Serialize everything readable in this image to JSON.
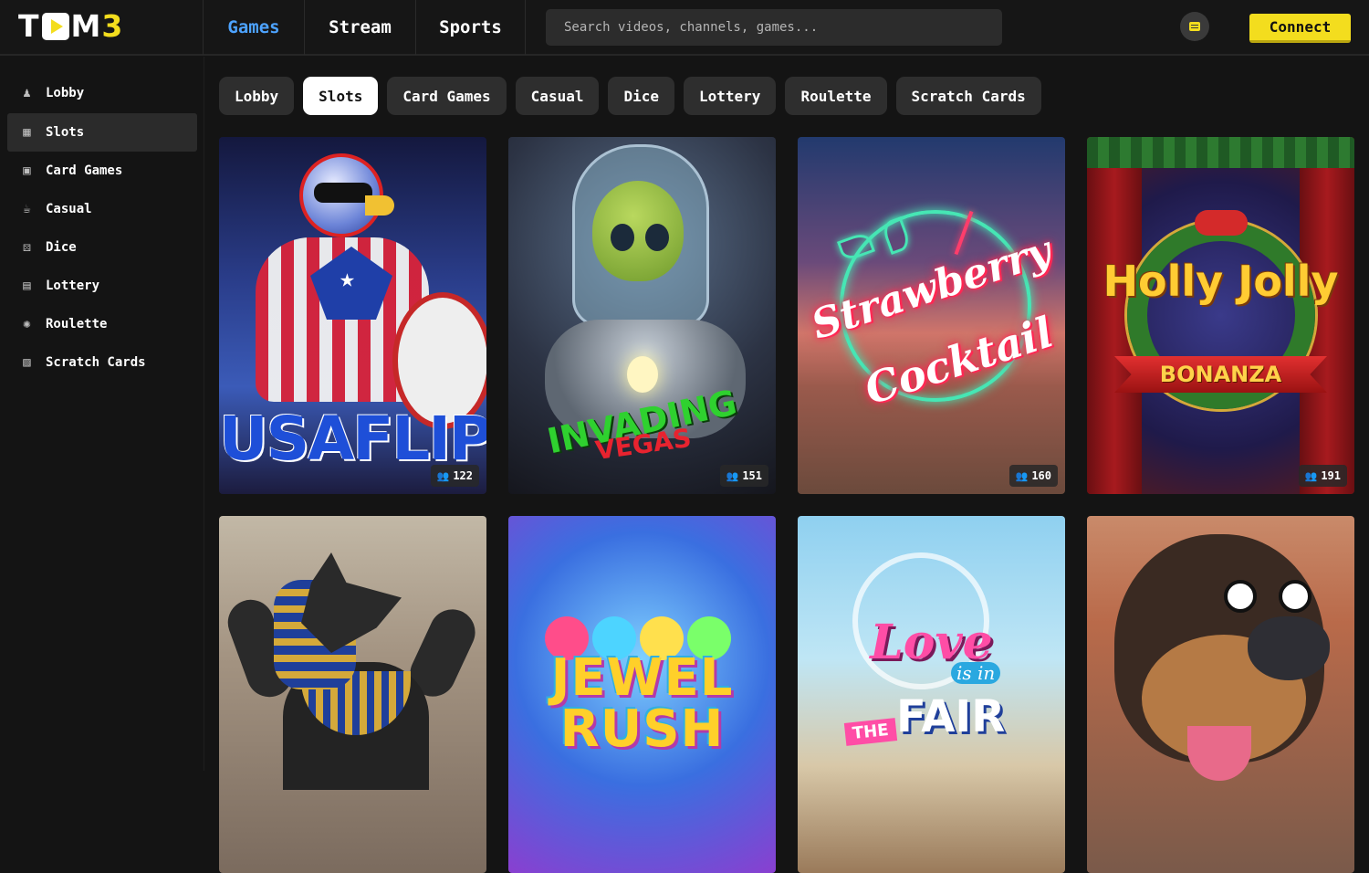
{
  "header": {
    "logo": {
      "part1": "T",
      "part2": "M",
      "part3": "3"
    },
    "tabs": [
      {
        "label": "Games",
        "active": true
      },
      {
        "label": "Stream",
        "active": false
      },
      {
        "label": "Sports",
        "active": false
      }
    ],
    "search": {
      "placeholder": "Search videos, channels, games...",
      "value": ""
    },
    "chat_icon": "chat-icon",
    "connect_label": "Connect"
  },
  "sidebar": {
    "items": [
      {
        "label": "Lobby",
        "icon": "lobby-icon",
        "active": false
      },
      {
        "label": "Slots",
        "icon": "slots-icon",
        "active": true
      },
      {
        "label": "Card Games",
        "icon": "card-games-icon",
        "active": false
      },
      {
        "label": "Casual",
        "icon": "casual-icon",
        "active": false
      },
      {
        "label": "Dice",
        "icon": "dice-icon",
        "active": false
      },
      {
        "label": "Lottery",
        "icon": "lottery-icon",
        "active": false
      },
      {
        "label": "Roulette",
        "icon": "roulette-icon",
        "active": false
      },
      {
        "label": "Scratch Cards",
        "icon": "scratch-cards-icon",
        "active": false
      }
    ]
  },
  "categories": [
    {
      "label": "Lobby",
      "active": false
    },
    {
      "label": "Slots",
      "active": true
    },
    {
      "label": "Card Games",
      "active": false
    },
    {
      "label": "Casual",
      "active": false
    },
    {
      "label": "Dice",
      "active": false
    },
    {
      "label": "Lottery",
      "active": false
    },
    {
      "label": "Roulette",
      "active": false
    },
    {
      "label": "Scratch Cards",
      "active": false
    }
  ],
  "games": [
    {
      "art_text": "USAFLIP",
      "players": "122"
    },
    {
      "art_text": "INVADING",
      "art_sub": "VEGAS",
      "players": "151"
    },
    {
      "art_text": "Strawberry",
      "art_sub": "Cocktail",
      "players": "160"
    },
    {
      "art_text": "Holly Jolly",
      "art_sub": "BONANZA",
      "players": "191"
    },
    {
      "art_text": "",
      "players": ""
    },
    {
      "art_text": "JEWEL RUSH",
      "players": ""
    },
    {
      "art_text": "Love",
      "art_isin": "is in",
      "art_the": "THE",
      "art_sub": "FAIR",
      "players": ""
    },
    {
      "art_text": "",
      "players": ""
    }
  ],
  "colors": {
    "accent": "#f3dd1e",
    "active_tab": "#4da3ff",
    "background": "#141414"
  }
}
